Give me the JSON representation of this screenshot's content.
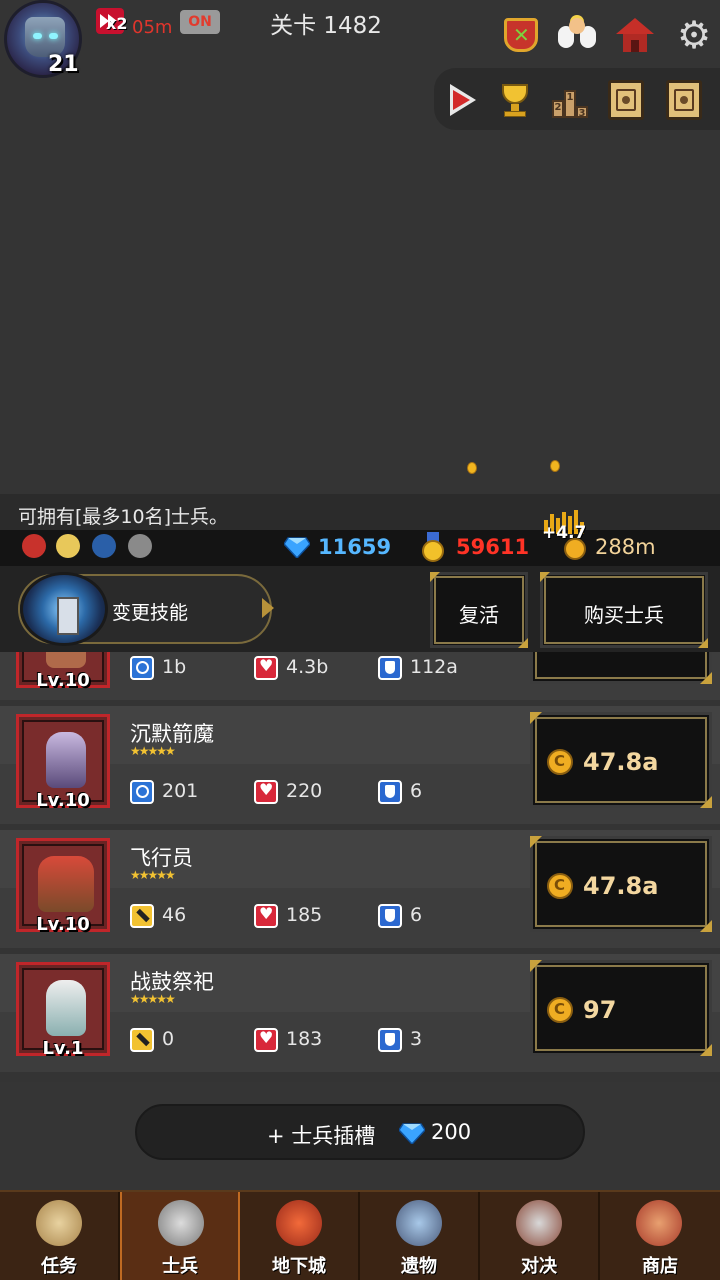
{
  "hud": {
    "player_level": "21",
    "speed_multiplier": "x2",
    "speed_time": "05m",
    "toggle_label": "ON",
    "stage_title": "关卡 1482"
  },
  "top_icons": [
    "guild-banner-icon",
    "angel-icon",
    "mailbox-house-icon",
    "gear-icon"
  ],
  "toolbar_icons": [
    "play-video-icon",
    "trophy-icon",
    "ranking-podium-icon",
    "quest-book-icon",
    "journal-book-icon"
  ],
  "info": {
    "message": "可拥有[最多10名]士兵。"
  },
  "resources": {
    "diamonds": "11659",
    "medals": "59611",
    "gold_delta": "+4.7",
    "gold": "288m"
  },
  "actions": {
    "change_skill": "变更技能",
    "revive": "复活",
    "buy_soldier": "购买士兵"
  },
  "soldiers": [
    {
      "name": "",
      "level": "Lv.10",
      "attack": "1b",
      "hp": "4.3b",
      "defense": "112a",
      "price": ""
    },
    {
      "name": "沉默箭魔",
      "level": "Lv.10",
      "stars": "★★★★★",
      "attack": "201",
      "hp": "220",
      "defense": "6",
      "price": "47.8a"
    },
    {
      "name": "飞行员",
      "level": "Lv.10",
      "stars": "★★★★★",
      "attack": "46",
      "hp": "185",
      "defense": "6",
      "price": "47.8a"
    },
    {
      "name": "战鼓祭祀",
      "level": "Lv.1",
      "stars": "★★★★★",
      "attack": "0",
      "hp": "183",
      "defense": "3",
      "price": "97"
    }
  ],
  "add_slot": {
    "label": "+ 士兵插槽",
    "cost": "200"
  },
  "nav": {
    "tabs": [
      "任务",
      "士兵",
      "地下城",
      "遗物",
      "对决",
      "商店"
    ],
    "active": "士兵"
  },
  "colors": {
    "diamond": "#56b7ff",
    "medal": "#ff3326",
    "gold_text": "#f2d39a",
    "portrait_border": "#c0262a",
    "nav_active": "#5a2e14"
  }
}
